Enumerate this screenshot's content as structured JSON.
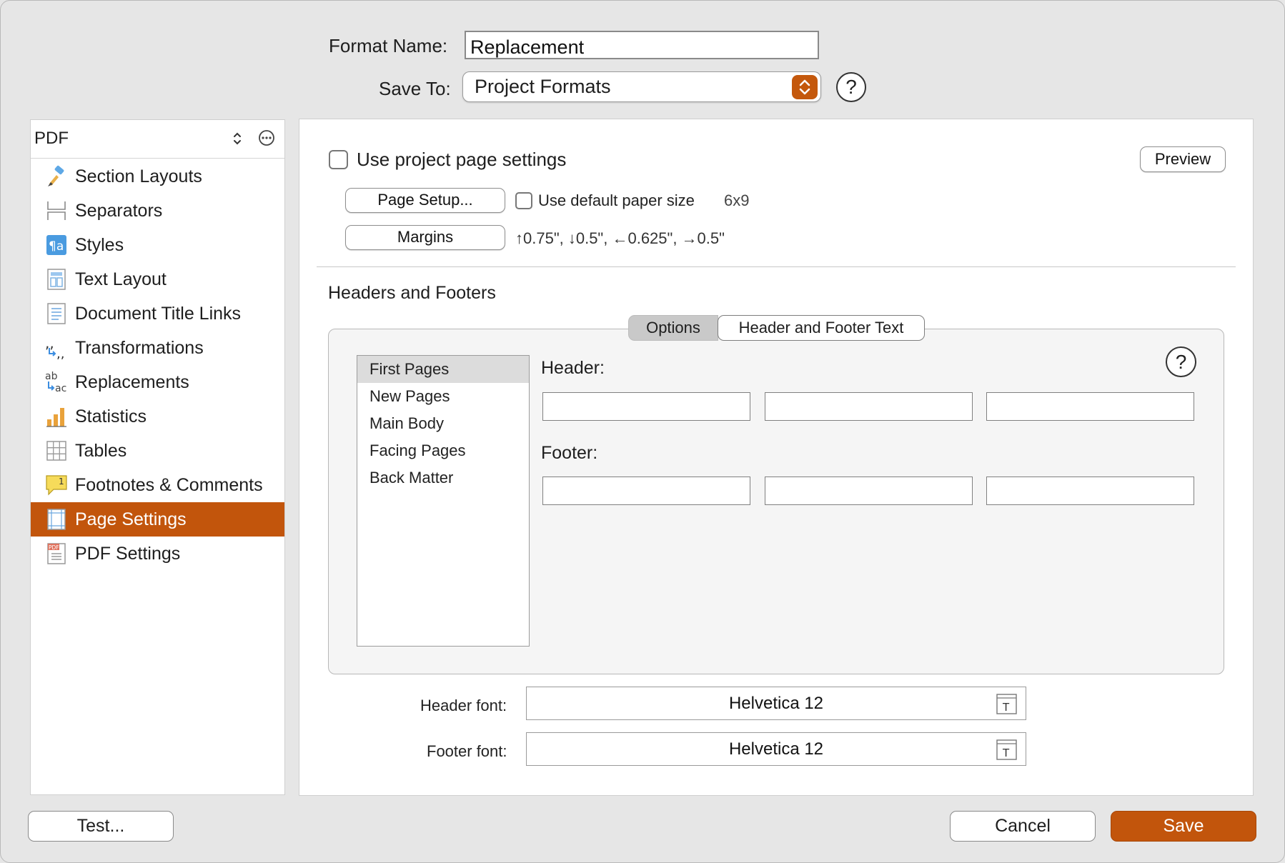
{
  "header": {
    "format_name_label": "Format Name:",
    "format_name_value": "Replacement",
    "save_to_label": "Save To:",
    "save_to_value": "Project Formats",
    "help": "?"
  },
  "sidebar": {
    "selector_value": "PDF",
    "items": [
      {
        "label": "Section Layouts",
        "icon": "paintbrush-icon"
      },
      {
        "label": "Separators",
        "icon": "separator-icon"
      },
      {
        "label": "Styles",
        "icon": "styles-icon"
      },
      {
        "label": "Text Layout",
        "icon": "text-layout-icon"
      },
      {
        "label": "Document Title Links",
        "icon": "document-lines-icon"
      },
      {
        "label": "Transformations",
        "icon": "quotes-transform-icon"
      },
      {
        "label": "Replacements",
        "icon": "replacements-icon"
      },
      {
        "label": "Statistics",
        "icon": "bar-chart-icon"
      },
      {
        "label": "Tables",
        "icon": "table-grid-icon"
      },
      {
        "label": "Footnotes & Comments",
        "icon": "footnote-comment-icon"
      },
      {
        "label": "Page Settings",
        "icon": "page-settings-icon",
        "selected": true
      },
      {
        "label": "PDF Settings",
        "icon": "pdf-file-icon"
      }
    ]
  },
  "page": {
    "use_project_settings_label": "Use project page settings",
    "preview_label": "Preview",
    "page_setup_label": "Page Setup...",
    "use_default_paper_label": "Use default paper size",
    "paper_size": "6x9",
    "margins_label": "Margins",
    "margins_value": "↑0.75\", ↓0.5\", ←0.625\", →0.5\""
  },
  "headers_footers": {
    "section_title": "Headers and Footers",
    "tabs": [
      "Options",
      "Header and Footer Text"
    ],
    "active_tab": "Options",
    "page_types": [
      "First Pages",
      "New Pages",
      "Main Body",
      "Facing Pages",
      "Back Matter"
    ],
    "selected_page_type": "First Pages",
    "header_label": "Header:",
    "footer_label": "Footer:",
    "help": "?"
  },
  "fonts": {
    "header_font_label": "Header font:",
    "header_font_value": "Helvetica 12",
    "footer_font_label": "Footer font:",
    "footer_font_value": "Helvetica 12"
  },
  "footer_buttons": {
    "test_label": "Test...",
    "cancel_label": "Cancel",
    "save_label": "Save"
  },
  "colors": {
    "accent": "#c2550c"
  }
}
